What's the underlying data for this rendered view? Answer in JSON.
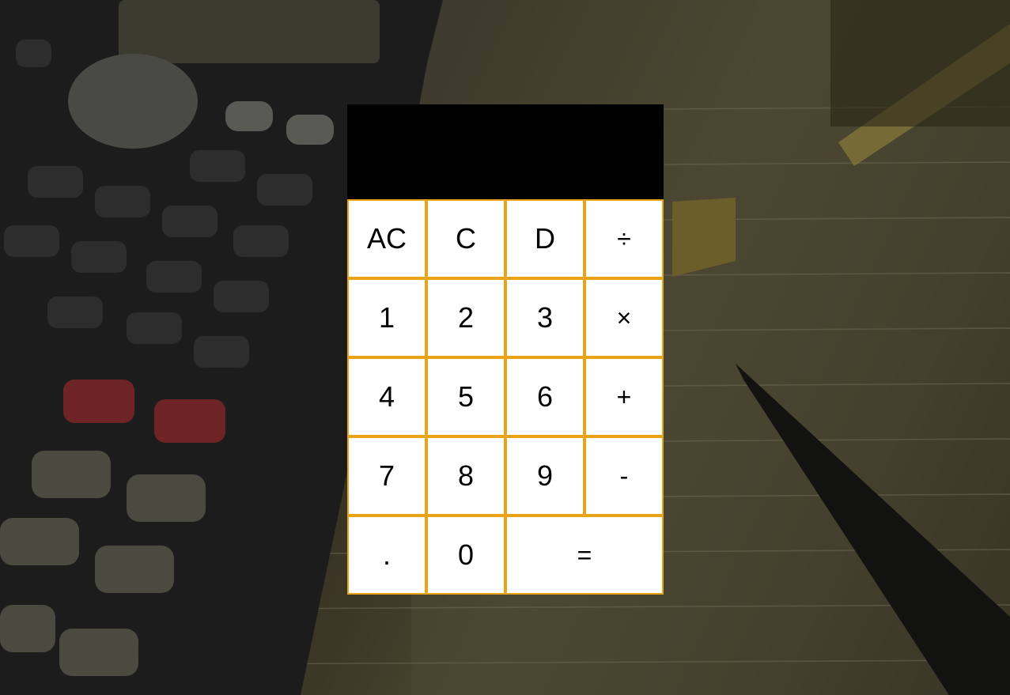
{
  "display": {
    "value": ""
  },
  "keys": [
    {
      "label": "AC"
    },
    {
      "label": "C"
    },
    {
      "label": "D"
    },
    {
      "label": "÷"
    },
    {
      "label": "1"
    },
    {
      "label": "2"
    },
    {
      "label": "3"
    },
    {
      "label": "×"
    },
    {
      "label": "4"
    },
    {
      "label": "5"
    },
    {
      "label": "6"
    },
    {
      "label": "+"
    },
    {
      "label": "7"
    },
    {
      "label": "8"
    },
    {
      "label": "9"
    },
    {
      "label": "-"
    },
    {
      "label": "."
    },
    {
      "label": "0"
    },
    {
      "label": "="
    }
  ],
  "colors": {
    "display_bg": "#000000",
    "key_bg": "#ffffff",
    "key_border": "#e8a317",
    "key_text": "#000000"
  }
}
